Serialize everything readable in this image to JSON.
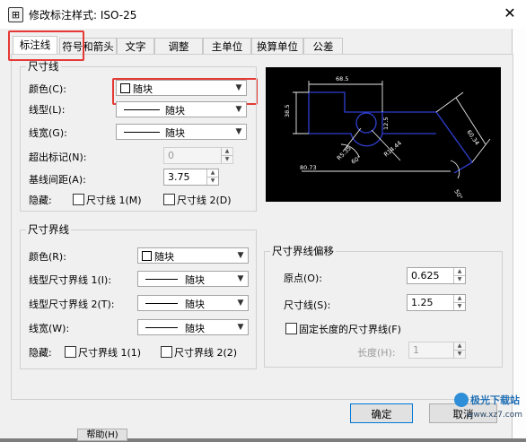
{
  "window": {
    "title": "修改标注样式: ISO-25",
    "icon": "dimension-style-icon",
    "close_glyph": "✕"
  },
  "tabs": [
    {
      "label": "标注线",
      "active": true
    },
    {
      "label": "符号和箭头"
    },
    {
      "label": "文字"
    },
    {
      "label": "调整"
    },
    {
      "label": "主单位"
    },
    {
      "label": "换算单位"
    },
    {
      "label": "公差"
    }
  ],
  "dim_line": {
    "legend": "尺寸线",
    "color_label": "颜色(C):",
    "color_value": "随块",
    "linetype_label": "线型(L):",
    "linetype_value": "随块",
    "lineweight_label": "线宽(G):",
    "lineweight_value": "随块",
    "extend_label": "超出标记(N):",
    "extend_value": "0",
    "baseline_label": "基线间距(A):",
    "baseline_value": "3.75",
    "hide_label": "隐藏:",
    "hide1": "尺寸线 1(M)",
    "hide2": "尺寸线 2(D)"
  },
  "ext_line": {
    "legend": "尺寸界线",
    "color_label": "颜色(R):",
    "color_value": "随块",
    "lt1_label": "线型尺寸界线 1(I):",
    "lt1_value": "随块",
    "lt2_label": "线型尺寸界线 2(T):",
    "lt2_value": "随块",
    "lw_label": "线宽(W):",
    "lw_value": "随块",
    "hide_label": "隐藏:",
    "hide1": "尺寸界线 1(1)",
    "hide2": "尺寸界线 2(2)"
  },
  "offset": {
    "legend": "尺寸界线偏移",
    "origin_label": "原点(O):",
    "origin_value": "0.625",
    "dimline_label": "尺寸线(S):",
    "dimline_value": "1.25",
    "fixed_label": "固定长度的尺寸界线(F)",
    "length_label": "长度(H):",
    "length_value": "1"
  },
  "preview": {
    "labels": [
      "68.5",
      "38.5",
      "R14.44",
      "80.73",
      "60°",
      "R5.35",
      "60.34",
      "50°",
      "12.5"
    ]
  },
  "buttons": {
    "ok": "确定",
    "cancel": "取消",
    "help": "帮助(H)"
  },
  "watermark": {
    "brand": "极光下载站",
    "url": "www.xz7.com"
  },
  "colors": {
    "highlight": "#e53935",
    "preview_bg": "#000000",
    "preview_line": "#2f3fd0"
  }
}
